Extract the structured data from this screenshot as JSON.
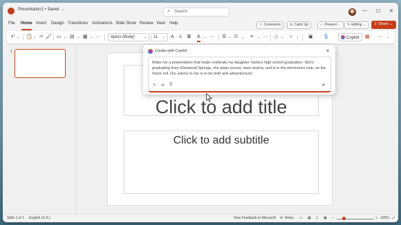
{
  "title_bar": {
    "doc_title": "Presentation1 • Saved",
    "search_placeholder": "Search",
    "window_controls": [
      "—",
      "☐",
      "✕"
    ]
  },
  "menu": {
    "items": [
      "File",
      "Home",
      "Insert",
      "Design",
      "Transitions",
      "Animations",
      "Slide Show",
      "Review",
      "View",
      "Help"
    ],
    "active": "Home",
    "comments_label": "Comments",
    "catchup_label": "Catch Up",
    "present_label": "Present",
    "editing_label": "Editing",
    "share_label": "Share"
  },
  "ribbon": {
    "font_name": "Aptos (Body)",
    "font_size": "11",
    "copilot_label": "Copilot"
  },
  "thumbnails": {
    "slide_number": "1"
  },
  "slide": {
    "title_placeholder": "Click to add title",
    "subtitle_placeholder": "Click to add subtitle"
  },
  "copilot_dialog": {
    "title": "Create with Copilot",
    "prompt_text": "Make me a presentation that helps celebrate my daughter Tasha's high school graduation. She's graduating from Glenwood Springs, she plays soccer, does drama, and is in the electronics club, on the honor roll. Our advice to her is to be bold and adventurous!|"
  },
  "status_bar": {
    "slide_info": "Slide 1 of 1",
    "language": "English (U.S.)",
    "feedback": "Give Feedback to Microsoft",
    "notes": "Notes",
    "zoom_level": "100%"
  },
  "colors": {
    "accent": "#c43e1c"
  }
}
